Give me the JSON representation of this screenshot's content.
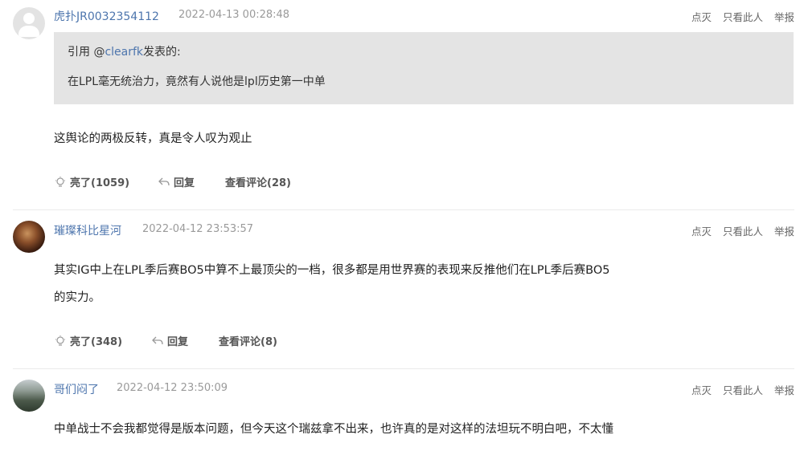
{
  "ops_labels": {
    "dislike": "点灭",
    "only_this": "只看此人",
    "report": "举报"
  },
  "replies": [
    {
      "username": "虎扑JR0032354112",
      "time": "2022-04-13 00:28:48",
      "quote": {
        "prefix": "引用 @",
        "mention": "clearfk",
        "suffix": "发表的:",
        "text": "在LPL毫无统治力，竟然有人说他是lpl历史第一中单"
      },
      "content": [
        "这舆论的两极反转，真是令人叹为观止"
      ],
      "like": "亮了(1059)",
      "reply": "回复",
      "view_comments": "查看评论(28)"
    },
    {
      "username": "璀璨科比星河",
      "time": "2022-04-12 23:53:57",
      "content": [
        "其实IG中上在LPL季后赛BO5中算不上最顶尖的一档，很多都是用世界赛的表现来反推他们在LPL季后赛BO5",
        "的实力。"
      ],
      "like": "亮了(348)",
      "reply": "回复",
      "view_comments": "查看评论(8)"
    },
    {
      "username": "哥们闷了",
      "time": "2022-04-12 23:50:09",
      "content": [
        "中单战士不会我都觉得是版本问题，但今天这个瑞兹拿不出来，也许真的是对这样的法坦玩不明白吧，不太懂"
      ]
    }
  ]
}
